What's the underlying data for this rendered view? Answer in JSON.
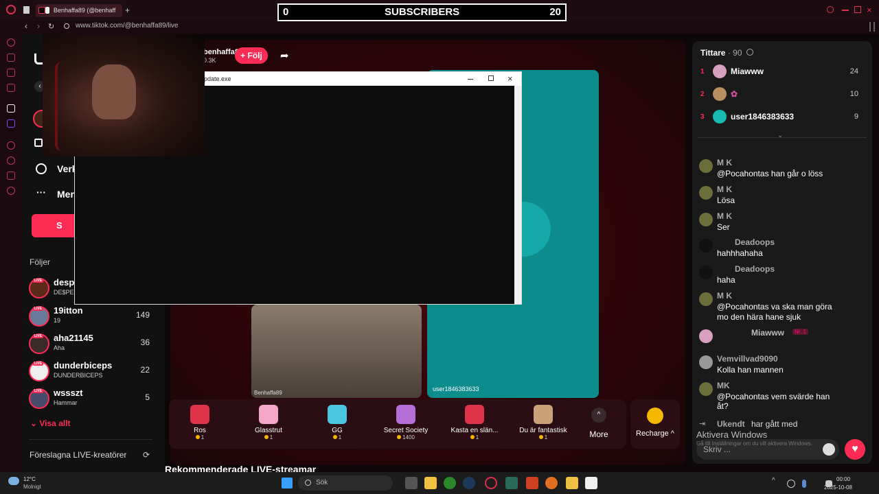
{
  "browser": {
    "tab_title": "Benhaffa89 (@benhaff",
    "url": "www.tiktok.com/@benhaffa89/live",
    "add_tab": "+"
  },
  "banner": {
    "left": "0",
    "label": "SUBSCRIBERS",
    "right": "20"
  },
  "stream": {
    "host_name": "benhaffa89",
    "host_sub": "0.3K",
    "follow_label": "+ Följ",
    "window_title": "pdate.exe",
    "guest1_label": "Benhaffa89",
    "guest2_label": "user1846383633"
  },
  "leftnav": {
    "item_explore": "Verk",
    "item_more": "Mer",
    "btn_s": "S",
    "following_header": "Följer",
    "following": [
      {
        "name": "desp",
        "sub": "DE$PE",
        "count": ""
      },
      {
        "name": "19itton",
        "sub": "19",
        "count": "149"
      },
      {
        "name": "aha21145",
        "sub": "Aha",
        "count": "36"
      },
      {
        "name": "dunderbiceps",
        "sub": "DUNDERBICEPS",
        "count": "22"
      },
      {
        "name": "wssszt",
        "sub": "Hammar",
        "count": "5"
      }
    ],
    "show_all": "Visa allt",
    "suggested_header": "Föreslagna LIVE-kreatörer"
  },
  "recommended_header": "Rekommenderade LIVE-streamar",
  "gifts": [
    {
      "name": "Ros",
      "price": "1",
      "color": "#e0344a"
    },
    {
      "name": "Glasstrut",
      "price": "1",
      "color": "#f3a6c8"
    },
    {
      "name": "GG",
      "price": "1",
      "color": "#4bc6e0"
    },
    {
      "name": "Secret Society",
      "price": "1400",
      "color": "#b46fd6"
    },
    {
      "name": "Kasta en slän...",
      "price": "1",
      "color": "#e0344a"
    },
    {
      "name": "Du är fantastisk",
      "price": "1",
      "color": "#c9a27a"
    }
  ],
  "more_label": "More",
  "recharge_label": "Recharge ^",
  "panel": {
    "viewers_label": "Tittare",
    "viewers_count": "· 90",
    "viewers": [
      {
        "rank": "1",
        "name": "Miawww",
        "count": "24",
        "color": "#d8a0c0"
      },
      {
        "rank": "2",
        "name": "",
        "count": "10",
        "color": "#b89060"
      },
      {
        "rank": "3",
        "name": "user1846383633",
        "count": "9",
        "color": "#17b8b0"
      }
    ],
    "chat": [
      {
        "name": "M K",
        "text": "@Pocahontas  han går o löss"
      },
      {
        "name": "M K",
        "text": "Lösa"
      },
      {
        "name": "M K",
        "text": "Ser"
      },
      {
        "name": "Deadoops",
        "text": "hahhhahaha"
      },
      {
        "name": "Deadoops",
        "text": "haha"
      },
      {
        "name": "M K",
        "text": "@Pocahontas  va ska man göra"
      },
      {
        "name": "",
        "text": "mo den hära hane sjuk"
      },
      {
        "name": "Miawww",
        "text": "Nr. 1"
      },
      {
        "name": "Vemvillvad9090",
        "text": "Kolla han mannen"
      },
      {
        "name": "MK",
        "text": "@Pocahontas  vem svärde han"
      },
      {
        "name": "",
        "text": "åt?"
      }
    ],
    "joined_name": "Ukendt",
    "joined_text": "har gått med",
    "input_placeholder": "Skriv ...",
    "watermark_title": "Aktivera Windows",
    "watermark_sub": "Gå till Inställningar om du vill aktivera Windows."
  },
  "taskbar": {
    "temp": "12°C",
    "weather": "Molnigt",
    "search": "Sök",
    "time": "00:00",
    "date": "2025-10-08"
  }
}
